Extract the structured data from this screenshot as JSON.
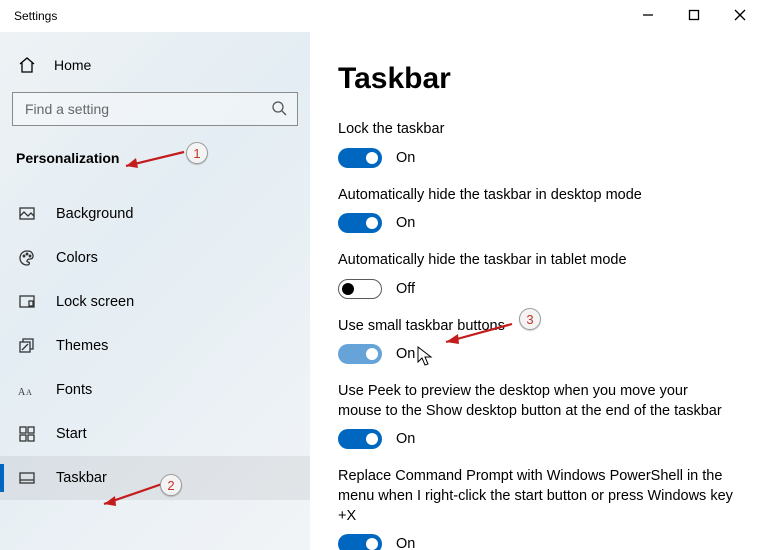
{
  "window": {
    "title": "Settings"
  },
  "sidebar": {
    "home": "Home",
    "search_placeholder": "Find a setting",
    "category": "Personalization",
    "items": [
      {
        "label": "Background",
        "selected": false
      },
      {
        "label": "Colors",
        "selected": false
      },
      {
        "label": "Lock screen",
        "selected": false
      },
      {
        "label": "Themes",
        "selected": false
      },
      {
        "label": "Fonts",
        "selected": false
      },
      {
        "label": "Start",
        "selected": false
      },
      {
        "label": "Taskbar",
        "selected": true
      }
    ]
  },
  "page": {
    "title": "Taskbar",
    "settings": [
      {
        "caption": "Lock the taskbar",
        "on": true,
        "state_label": "On"
      },
      {
        "caption": "Automatically hide the taskbar in desktop mode",
        "on": true,
        "state_label": "On"
      },
      {
        "caption": "Automatically hide the taskbar in tablet mode",
        "on": false,
        "state_label": "Off"
      },
      {
        "caption": "Use small taskbar buttons",
        "on": true,
        "state_label": "On",
        "faded": true
      },
      {
        "caption": "Use Peek to preview the desktop when you move your mouse to the Show desktop button at the end of the taskbar",
        "on": true,
        "state_label": "On"
      },
      {
        "caption": "Replace Command Prompt with Windows PowerShell in the menu when I right-click the start button or press Windows key +X",
        "on": true,
        "state_label": "On"
      }
    ]
  },
  "annotations": {
    "callouts": [
      "1",
      "2",
      "3"
    ]
  }
}
